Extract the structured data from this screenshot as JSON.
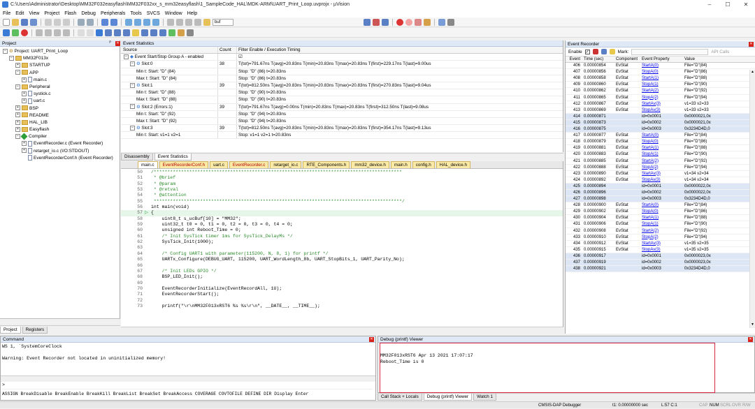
{
  "window": {
    "title": "C:\\Users\\Administrator\\Desktop\\MM32F032easyflash\\MM32F032xx_s_mm32easyflash\\1_SampleCode_HAL\\MDK-ARM\\UART_Print_Loop.uvprojx - µVision",
    "minimize": "–",
    "maximize": "☐",
    "close": "✕"
  },
  "menu": [
    "File",
    "Edit",
    "View",
    "Project",
    "Flash",
    "Debug",
    "Peripherals",
    "Tools",
    "SVCS",
    "Window",
    "Help"
  ],
  "toolbar": {
    "build_target": "buf"
  },
  "project": {
    "header": "Project",
    "root": "Project: UART_Print_Loop",
    "items": [
      {
        "label": "MM32F013x",
        "depth": 1,
        "kind": "folder",
        "exp": "−"
      },
      {
        "label": "STARTUP",
        "depth": 2,
        "kind": "folder",
        "exp": "+"
      },
      {
        "label": "APP",
        "depth": 2,
        "kind": "folder",
        "exp": "−"
      },
      {
        "label": "main.c",
        "depth": 3,
        "kind": "file",
        "exp": "+"
      },
      {
        "label": "Peripheral",
        "depth": 2,
        "kind": "folder",
        "exp": "−"
      },
      {
        "label": "systick.c",
        "depth": 3,
        "kind": "file",
        "exp": "+"
      },
      {
        "label": "uart.c",
        "depth": 3,
        "kind": "file",
        "exp": "+"
      },
      {
        "label": "BSP",
        "depth": 2,
        "kind": "folder",
        "exp": "+"
      },
      {
        "label": "README",
        "depth": 2,
        "kind": "folder",
        "exp": "+"
      },
      {
        "label": "HAL_LIB",
        "depth": 2,
        "kind": "folder",
        "exp": "+"
      },
      {
        "label": "Easyflash",
        "depth": 2,
        "kind": "folder",
        "exp": "+"
      },
      {
        "label": "Compiler",
        "depth": 2,
        "kind": "diamond",
        "exp": "−"
      },
      {
        "label": "EventRecorder.c (Event Recorder)",
        "depth": 3,
        "kind": "file",
        "exp": "+"
      },
      {
        "label": "retarget_io.c (I/O:STDOUT)",
        "depth": 3,
        "kind": "file",
        "exp": "+"
      },
      {
        "label": "EventRecorderConf.h (Event Recorder)",
        "depth": 3,
        "kind": "file",
        "exp": ""
      }
    ],
    "tab_project": "Project",
    "tab_registers": "Registers"
  },
  "event_stats": {
    "header": "Event Statistics",
    "col_source": "Source",
    "col_count": "Count",
    "col_filter": "Filter Enable / Execution Timing",
    "rows": [
      {
        "source": "Event Start/Stop Group A - enabled",
        "count": "",
        "timing": "☑",
        "indent": 0,
        "exp": "−"
      },
      {
        "source": "Slot:0",
        "count": "38",
        "timing": "T(tot)=791.67ns T(avg)=20.83ns T(min)=20.83ns T(max)=20.83ns T(first)=229.17ns T(last)=9.00us",
        "indent": 1,
        "exp": "−"
      },
      {
        "source": "Min t: Start: \"D\" (84)",
        "count": "",
        "timing": "Stop: \"D\" (86) t=20.83ns",
        "indent": 2,
        "exp": ""
      },
      {
        "source": "Max t: Start: \"D\" (84)",
        "count": "",
        "timing": "Stop: \"D\" (86) t=20.83ns",
        "indent": 2,
        "exp": ""
      },
      {
        "source": "Slot:1",
        "count": "39",
        "timing": "T(tot)=812.50ns T(avg)=20.83ns T(min)=20.83ns T(max)=20.83ns T(first)=270.83ns T(last)=9.04us",
        "indent": 1,
        "exp": "−"
      },
      {
        "source": "Min t: Start: \"D\" (88)",
        "count": "",
        "timing": "Stop: \"D\" (90) t=20.83ns",
        "indent": 2,
        "exp": ""
      },
      {
        "source": "Max t: Start: \"D\" (88)",
        "count": "",
        "timing": "Stop: \"D\" (90) t=20.83ns",
        "indent": 2,
        "exp": ""
      },
      {
        "source": "Slot:2 (Errors:1)",
        "count": "39",
        "timing": "T(tot)=791.67ns T(avg)=0.00ns T(min)=20.83ns T(max)=20.83ns T(first)=312.50ns T(last)=9.08us",
        "indent": 1,
        "exp": "−"
      },
      {
        "source": "Min t: Start: \"D\" (92)",
        "count": "",
        "timing": "Stop: \"D\" (94) t=20.83ns",
        "indent": 2,
        "exp": ""
      },
      {
        "source": "Max t: Start: \"D\" (92)",
        "count": "",
        "timing": "Stop: \"D\" (94) t=20.83ns",
        "indent": 2,
        "exp": ""
      },
      {
        "source": "Slot:3",
        "count": "39",
        "timing": "T(tot)=812.50ns T(avg)=20.83ns T(min)=20.83ns T(max)=20.83ns T(first)=354.17ns T(last)=9.13us",
        "indent": 1,
        "exp": "−"
      },
      {
        "source": "Min t: Start: v1=1 v2=1",
        "count": "",
        "timing": "Stop: v1=1 v2=1 t=20.83ns",
        "indent": 2,
        "exp": ""
      }
    ],
    "tab_disasm": "Disassembly",
    "tab_stats": "Event Statistics"
  },
  "editor": {
    "tabs": [
      {
        "label": "main.c",
        "active": true,
        "red": false
      },
      {
        "label": "EventRecorderConf.h",
        "active": false,
        "red": true
      },
      {
        "label": "uart.c",
        "active": false,
        "red": false
      },
      {
        "label": "EventRecorder.c",
        "active": false,
        "red": true
      },
      {
        "label": "retarget_io.c",
        "active": false,
        "red": false
      },
      {
        "label": "RTE_Components.h",
        "active": false,
        "red": false
      },
      {
        "label": "mm32_device.h",
        "active": false,
        "red": false
      },
      {
        "label": "main.h",
        "active": false,
        "red": false
      },
      {
        "label": "config.h",
        "active": false,
        "red": false
      },
      {
        "label": "HAL_device.h",
        "active": false,
        "red": false
      }
    ],
    "lines": [
      {
        "n": "50",
        "t": "/*******************************************************************************************",
        "c": "cm"
      },
      {
        "n": "51",
        "t": " * @brief",
        "c": "cm"
      },
      {
        "n": "52",
        "t": " * @param",
        "c": "cm"
      },
      {
        "n": "53",
        "t": " * @retval",
        "c": "cm"
      },
      {
        "n": "54",
        "t": " * @attention",
        "c": "cm"
      },
      {
        "n": "55",
        "t": " *******************************************************************************************/",
        "c": "cm"
      },
      {
        "n": "56",
        "t": "int main(void)",
        "c": ""
      },
      {
        "n": "57",
        "t": "{",
        "c": "",
        "hl": true
      },
      {
        "n": "58",
        "t": "    uint8_t s_ucBuf[10] = \"MM32\";",
        "c": ""
      },
      {
        "n": "59",
        "t": "    uint32_t t0 = 0, t1 = 0, t2 = 0, t3 = 0, t4 = 0;",
        "c": ""
      },
      {
        "n": "60",
        "t": "    unsigned int Reboot_Time = 0;",
        "c": ""
      },
      {
        "n": "61",
        "t": "    /* Init SysTick timer 1ms for SysTick_DelayMs */",
        "c": "cm"
      },
      {
        "n": "62",
        "t": "    SysTick_Init(1000);",
        "c": ""
      },
      {
        "n": "63",
        "t": "",
        "c": ""
      },
      {
        "n": "64",
        "t": "    /* Config UART1 with parameter(115200, N, 8, 1) for printf */",
        "c": "cm"
      },
      {
        "n": "65",
        "t": "    UARTx_Configure(DEBUG_UART, 115200, UART_WordLength_8b, UART_StopBits_1, UART_Parity_No);",
        "c": ""
      },
      {
        "n": "66",
        "t": "",
        "c": ""
      },
      {
        "n": "67",
        "t": "    /* Init LEDs GPIO */",
        "c": "cm"
      },
      {
        "n": "68",
        "t": "    BSP_LED_Init();",
        "c": ""
      },
      {
        "n": "69",
        "t": "",
        "c": ""
      },
      {
        "n": "70",
        "t": "    EventRecorderInitialize(EventRecordAll, 1U);",
        "c": ""
      },
      {
        "n": "71",
        "t": "    EventRecorderStart();",
        "c": ""
      },
      {
        "n": "72",
        "t": "",
        "c": ""
      },
      {
        "n": "73",
        "t": "    printf(\"\\r\\nMM32F013xRST6 %s %s\\r\\n\", __DATE__, __TIME__);",
        "c": ""
      }
    ]
  },
  "event_recorder": {
    "header": "Event Recorder",
    "enable_label": "Enable",
    "mark_label": "Mark:",
    "api_calls": "API Calls",
    "cols": [
      "Event",
      "Time (sec)",
      "Component",
      "Event Property",
      "Value"
    ],
    "rows": [
      [
        "406",
        "0.00000854",
        "EvStat",
        "StartA(0)",
        "File=\"D\"(84)"
      ],
      [
        "407",
        "0.00000856",
        "EvStat",
        "StopA(0)",
        "File=\"D\"(86)"
      ],
      [
        "408",
        "0.00000858",
        "EvStat",
        "StartA(1)",
        "File=\"D\"(88)"
      ],
      [
        "409",
        "0.00000860",
        "EvStat",
        "StopA(1)",
        "File=\"D\"(90)"
      ],
      [
        "410",
        "0.00000862",
        "EvStat",
        "StartA(2)",
        "File=\"D\"(92)"
      ],
      [
        "411",
        "0.00000865",
        "EvStat",
        "StopA(2)",
        "File=\"D\"(94)"
      ],
      [
        "412",
        "0.00000867",
        "EvStat",
        "StartAv(3)",
        "v1=33 v2=33"
      ],
      [
        "413",
        "0.00000869",
        "EvStat",
        "StopAv(3)",
        "v1=33 v2=33"
      ],
      [
        "414",
        "0.00000871",
        "",
        "id=0x0001",
        "0x0000021,0x"
      ],
      [
        "415",
        "0.00000873",
        "",
        "id=0x0002",
        "0x0000021,0x"
      ],
      [
        "416",
        "0.00000875",
        "",
        "id=0x0003",
        "0x3234D4D,0"
      ],
      [
        "417",
        "0.00000877",
        "EvStat",
        "StartA(0)",
        "File=\"D\"(84)"
      ],
      [
        "418",
        "0.00000879",
        "EvStat",
        "StopA(0)",
        "File=\"D\"(86)"
      ],
      [
        "419",
        "0.00000881",
        "EvStat",
        "StartA(1)",
        "File=\"D\"(88)"
      ],
      [
        "420",
        "0.00000883",
        "EvStat",
        "StopA(1)",
        "File=\"D\"(90)"
      ],
      [
        "421",
        "0.00000885",
        "EvStat",
        "StartA(2)",
        "File=\"D\"(92)"
      ],
      [
        "422",
        "0.00000888",
        "EvStat",
        "StopA(2)",
        "File=\"D\"(94)"
      ],
      [
        "423",
        "0.00000890",
        "EvStat",
        "StartAv(3)",
        "v1=34 v2=34"
      ],
      [
        "424",
        "0.00000892",
        "EvStat",
        "StopAv(3)",
        "v1=34 v2=34"
      ],
      [
        "425",
        "0.00000894",
        "",
        "id=0x0001",
        "0x0000022,0x"
      ],
      [
        "426",
        "0.00000896",
        "",
        "id=0x0002",
        "0x0000022,0x"
      ],
      [
        "427",
        "0.00000898",
        "",
        "id=0x0003",
        "0x3234D4D,0"
      ],
      [
        "428",
        "0.00000900",
        "EvStat",
        "StartA(0)",
        "File=\"D\"(84)"
      ],
      [
        "429",
        "0.00000902",
        "EvStat",
        "StopA(0)",
        "File=\"D\"(86)"
      ],
      [
        "430",
        "0.00000904",
        "EvStat",
        "StartA(1)",
        "File=\"D\"(88)"
      ],
      [
        "431",
        "0.00000906",
        "EvStat",
        "StopA(1)",
        "File=\"D\"(90)"
      ],
      [
        "432",
        "0.00000908",
        "EvStat",
        "StartA(2)",
        "File=\"D\"(92)"
      ],
      [
        "433",
        "0.00000910",
        "EvStat",
        "StopA(2)",
        "File=\"D\"(94)"
      ],
      [
        "434",
        "0.00000912",
        "EvStat",
        "StartAv(3)",
        "v1=35 v2=35"
      ],
      [
        "435",
        "0.00000915",
        "EvStat",
        "StopAv(3)",
        "v1=35 v2=35"
      ],
      [
        "436",
        "0.00000917",
        "",
        "id=0x0001",
        "0x0000023,0x"
      ],
      [
        "437",
        "0.00000919",
        "",
        "id=0x0002",
        "0x0000023,0x"
      ],
      [
        "438",
        "0.00000921",
        "",
        "id=0x0003",
        "0x3234D4D,0"
      ]
    ]
  },
  "command": {
    "header": "Command",
    "lines": [
      "WS 1, `SystemCoreClock",
      "",
      "Warning: Event Recorder not located in uninitialized memory!"
    ],
    "prompt": ">",
    "hint": "ASSIGN BreakDisable BreakEnable BreakKill BreakList BreakSet BreakAccess COVERAGE COVTOFILE DEFINE DIR Display Enter"
  },
  "printf": {
    "header": "Debug (printf) Viewer",
    "lines": [
      "MM32F013xRST6 Apr 13 2021 17:07:17",
      "Reboot_Time is 0"
    ],
    "tabs": [
      "Call Stack + Locals",
      "Debug (printf) Viewer",
      "Watch 1"
    ]
  },
  "status": {
    "debugger": "CMSIS-DAP Debugger",
    "time": "t1: 0.00000000 sec",
    "pos": "L:57 C:1",
    "caps": "CAP",
    "num": "NUM",
    "scrl": "SCRL",
    "ovr": "OVR",
    "rw": "R/W"
  }
}
